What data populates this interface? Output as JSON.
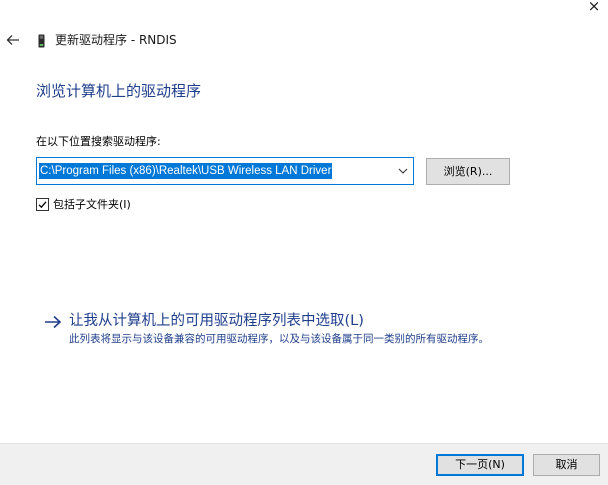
{
  "window": {
    "title": "更新驱动程序 - RNDIS",
    "close_glyph": "×"
  },
  "main": {
    "heading": "浏览计算机上的驱动程序",
    "search_label": "在以下位置搜索驱动程序:",
    "path_value": "C:\\Program Files (x86)\\Realtek\\USB Wireless LAN Driver",
    "browse_label": "浏览(R)...",
    "include_subfolders_label": "包括子文件夹(I)",
    "include_subfolders_checked": true,
    "pick_link": "让我从计算机上的可用驱动程序列表中选取(L)",
    "pick_description": "此列表将显示与该设备兼容的可用驱动程序，以及与该设备属于同一类别的所有驱动程序。"
  },
  "footer": {
    "next_label": "下一页(N)",
    "cancel_label": "取消"
  },
  "icons": {
    "back": "back-arrow-icon",
    "device": "usb-device-icon",
    "dropdown": "chevron-down-icon",
    "check": "checkmark-icon",
    "link_arrow": "arrow-right-icon"
  },
  "colors": {
    "accent": "#0078d7",
    "heading": "#1f3e8c",
    "footer_bg": "#f0f0f0"
  }
}
